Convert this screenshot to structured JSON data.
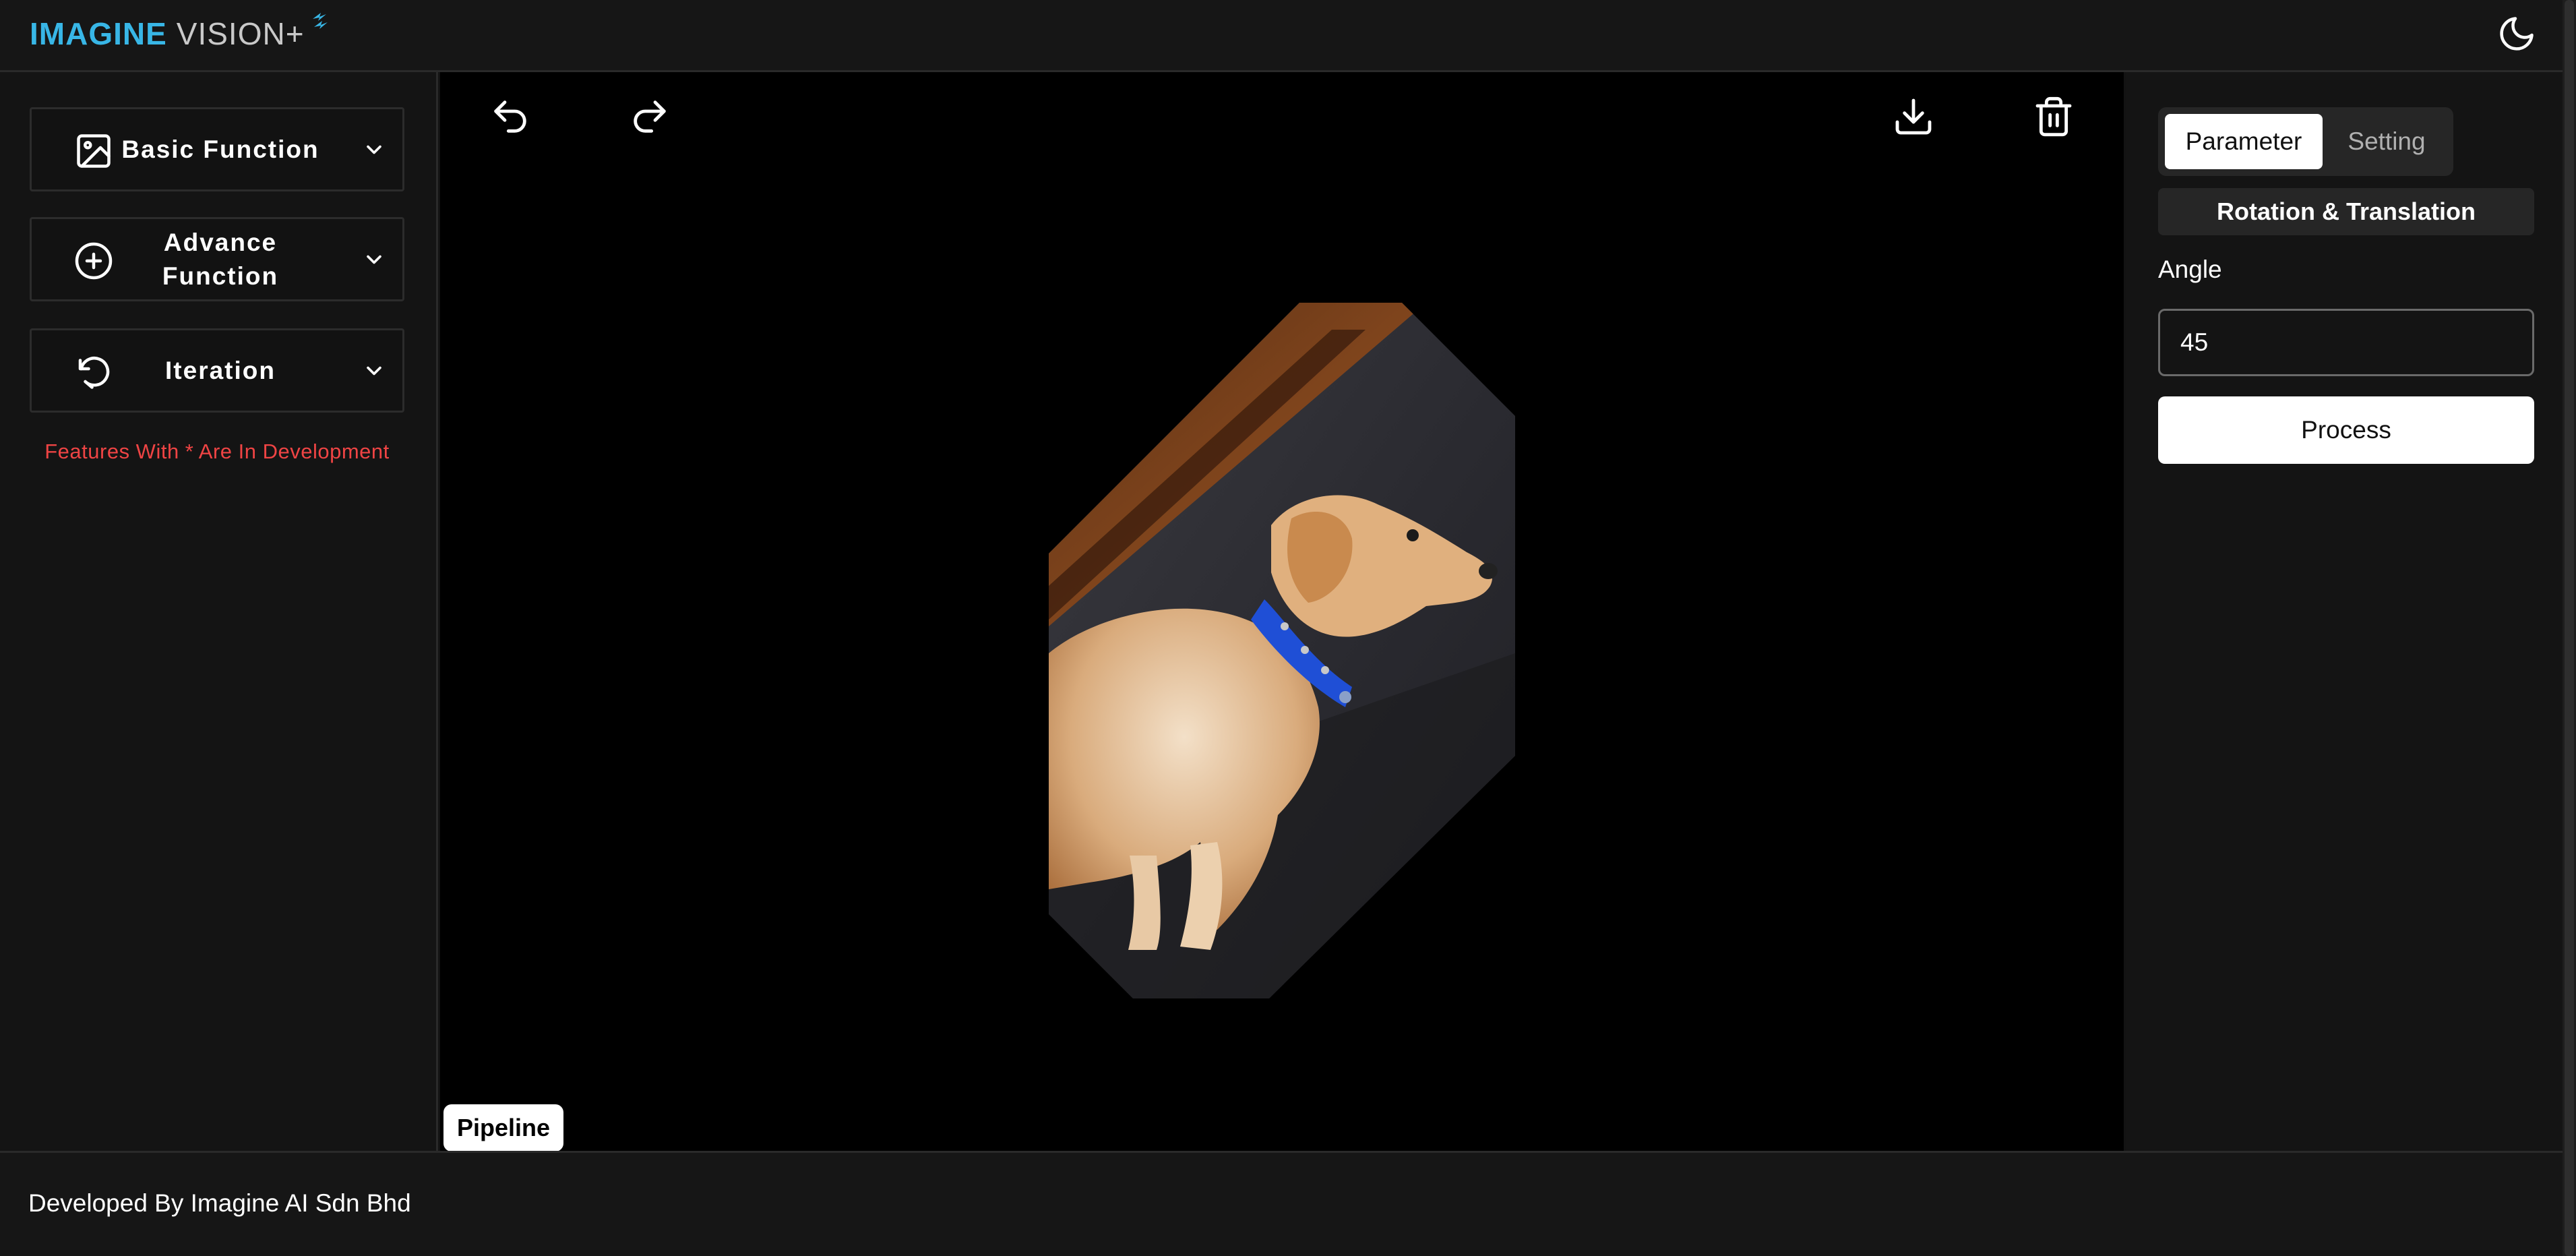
{
  "header": {
    "logo_primary": "IMAGINE",
    "logo_secondary": "VISION+",
    "theme_icon": "moon-icon"
  },
  "sidebar": {
    "items": [
      {
        "label": "Basic Function",
        "icon": "image-icon"
      },
      {
        "label": "Advance Function",
        "icon": "plus-circle-icon"
      },
      {
        "label": "Iteration",
        "icon": "rotate-ccw-icon"
      }
    ],
    "note": "Features With * Are In Development"
  },
  "canvas": {
    "toolbar": [
      "undo-icon",
      "redo-icon",
      "download-icon",
      "trash-icon"
    ],
    "image": {
      "subject": "puppy with blue collar",
      "rotation_deg": 45
    },
    "pipeline_label": "Pipeline"
  },
  "right_panel": {
    "tabs": [
      {
        "label": "Parameter",
        "active": true
      },
      {
        "label": "Setting",
        "active": false
      }
    ],
    "section_title": "Rotation & Translation",
    "angle_label": "Angle",
    "angle_value": "45",
    "process_label": "Process"
  },
  "footer": {
    "text": "Developed By Imagine AI Sdn Bhd"
  },
  "colors": {
    "accent": "#38b6e6",
    "background": "#131313",
    "canvas": "#000000",
    "warning": "#ef4444"
  }
}
